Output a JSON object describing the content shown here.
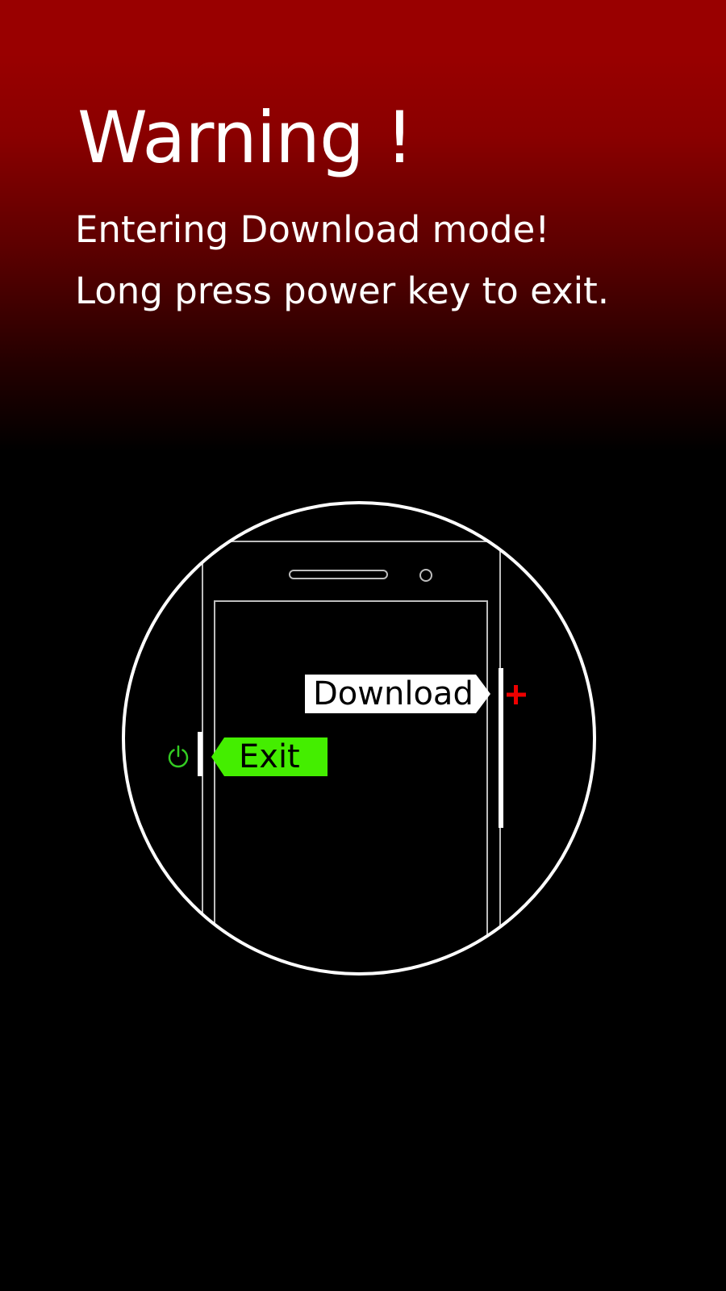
{
  "warning": {
    "title": "Warning !",
    "line1": "Entering Download mode!",
    "line2": "Long press power key to exit."
  },
  "illustration": {
    "download_label": "Download",
    "exit_label": "Exit",
    "volume_up_icon": "plus-icon",
    "power_icon": "power-icon"
  },
  "colors": {
    "header_red": "#990000",
    "background": "#000000",
    "exit_green": "#44ee00",
    "plus_red": "#ee0000",
    "power_green": "#33cc22",
    "line_white": "#ffffff"
  }
}
